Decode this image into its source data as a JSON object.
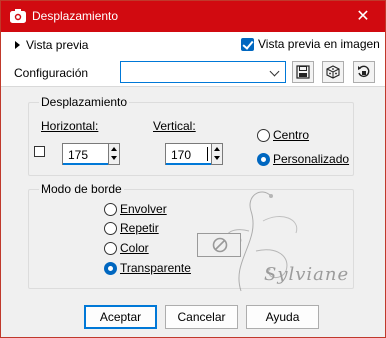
{
  "window": {
    "title": "Desplazamiento",
    "close_glyph": "✕"
  },
  "topbar": {
    "preview_label": "Vista previa",
    "live_preview_label": "Vista previa en imagen",
    "live_preview_checked": true
  },
  "config": {
    "label": "Configuración",
    "value": ""
  },
  "offset_group": {
    "legend": "Desplazamiento",
    "horizontal_label": "Horizontal:",
    "horizontal_value": "175",
    "vertical_label": "Vertical:",
    "vertical_value": "170",
    "center_label": "Centro",
    "custom_label": "Personalizado",
    "selected": "custom"
  },
  "edge_group": {
    "legend": "Modo de borde",
    "options": [
      "Envolver",
      "Repetir",
      "Color",
      "Transparente"
    ],
    "selected": "Transparente"
  },
  "watermark_text": "Sylviane",
  "buttons": {
    "ok": "Aceptar",
    "cancel": "Cancelar",
    "help": "Ayuda"
  },
  "colors": {
    "titlebar": "#d10a10",
    "accent": "#0078d7"
  },
  "icons": [
    "camera-icon",
    "save-icon",
    "dice-icon",
    "reset-icon",
    "no-color-icon"
  ]
}
